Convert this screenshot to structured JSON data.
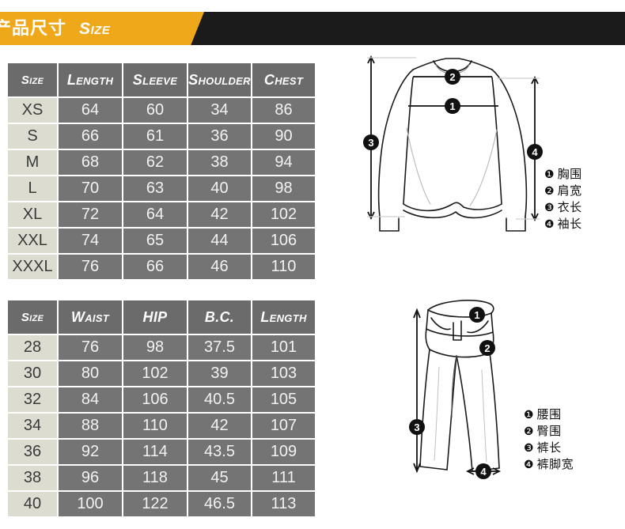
{
  "banner": {
    "title_cn": "产品尺寸",
    "title_en": "Size",
    "orange_color": "#efa81a",
    "dark_color": "#1b1b1b"
  },
  "colors": {
    "header_cell": "#6b6b6b",
    "data_cell": "#747474",
    "size_cell": "#dcdcd0",
    "accent": "#efa81a"
  },
  "tables": [
    {
      "name": "shirt-size-table",
      "columns": [
        "Size",
        "Length",
        "Sleeve",
        "Shoulder",
        "Chest"
      ],
      "rows": [
        [
          "XS",
          "64",
          "60",
          "34",
          "86"
        ],
        [
          "S",
          "66",
          "61",
          "36",
          "90"
        ],
        [
          "M",
          "68",
          "62",
          "38",
          "94"
        ],
        [
          "L",
          "70",
          "63",
          "40",
          "98"
        ],
        [
          "XL",
          "72",
          "64",
          "42",
          "102"
        ],
        [
          "XXL",
          "74",
          "65",
          "44",
          "106"
        ],
        [
          "XXXL",
          "76",
          "66",
          "46",
          "110"
        ]
      ]
    },
    {
      "name": "pants-size-table",
      "columns": [
        "Size",
        "Waist",
        "HIP",
        "B.C.",
        "Length"
      ],
      "rows": [
        [
          "28",
          "76",
          "98",
          "37.5",
          "101"
        ],
        [
          "30",
          "80",
          "102",
          "39",
          "103"
        ],
        [
          "32",
          "84",
          "106",
          "40.5",
          "105"
        ],
        [
          "34",
          "88",
          "110",
          "42",
          "107"
        ],
        [
          "36",
          "92",
          "114",
          "43.5",
          "109"
        ],
        [
          "38",
          "96",
          "118",
          "45",
          "111"
        ],
        [
          "40",
          "100",
          "122",
          "46.5",
          "113"
        ]
      ]
    }
  ],
  "shirt_legend": [
    {
      "marker": "❶",
      "label": "胸围"
    },
    {
      "marker": "❷",
      "label": "肩宽"
    },
    {
      "marker": "❸",
      "label": "衣长"
    },
    {
      "marker": "❹",
      "label": "袖长"
    }
  ],
  "pants_legend": [
    {
      "marker": "❶",
      "label": "腰围"
    },
    {
      "marker": "❷",
      "label": "臀围"
    },
    {
      "marker": "❸",
      "label": "裤长"
    },
    {
      "marker": "❹",
      "label": "裤脚宽"
    }
  ],
  "shirt_diagram_markers": [
    "1",
    "2",
    "3",
    "4"
  ],
  "pants_diagram_markers": [
    "1",
    "2",
    "3",
    "4"
  ]
}
